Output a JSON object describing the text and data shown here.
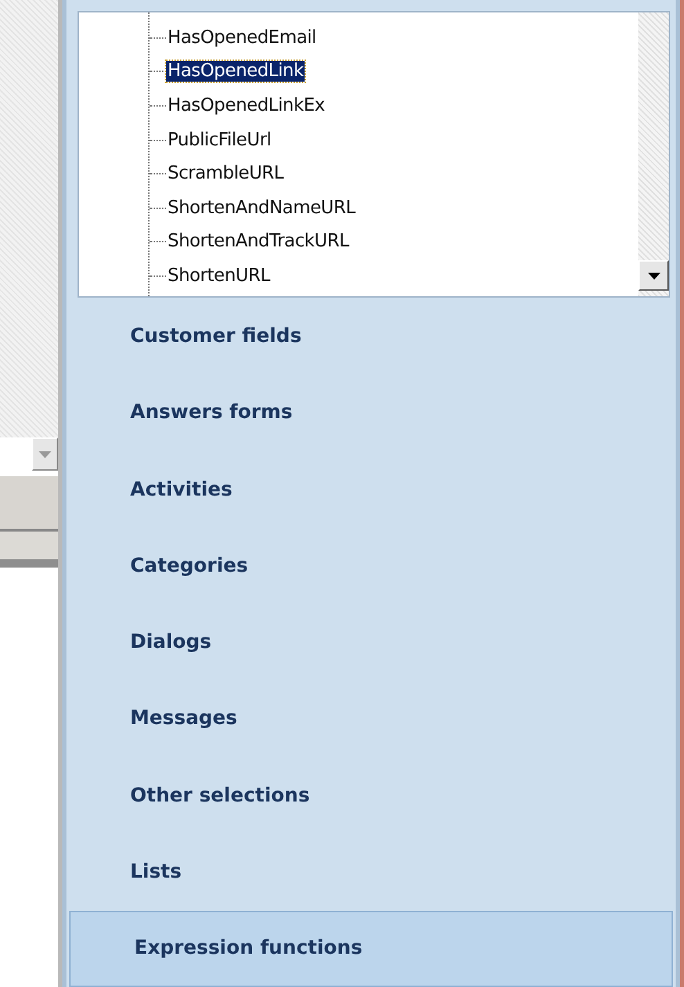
{
  "tree": {
    "items": [
      {
        "label": "HasOpenedEmail",
        "selected": false
      },
      {
        "label": "HasOpenedLink",
        "selected": true
      },
      {
        "label": "HasOpenedLinkEx",
        "selected": false
      },
      {
        "label": "PublicFileUrl",
        "selected": false
      },
      {
        "label": "ScrambleURL",
        "selected": false
      },
      {
        "label": "ShortenAndNameURL",
        "selected": false
      },
      {
        "label": "ShortenAndTrackURL",
        "selected": false
      },
      {
        "label": "ShortenURL",
        "selected": false
      }
    ]
  },
  "nav": {
    "items": [
      {
        "label": "Customer fields",
        "selected": false
      },
      {
        "label": "Answers forms",
        "selected": false
      },
      {
        "label": "Activities",
        "selected": false
      },
      {
        "label": "Categories",
        "selected": false
      },
      {
        "label": "Dialogs",
        "selected": false
      },
      {
        "label": "Messages",
        "selected": false
      },
      {
        "label": "Other selections",
        "selected": false
      },
      {
        "label": "Lists",
        "selected": false
      },
      {
        "label": "Expression functions",
        "selected": true
      }
    ]
  }
}
